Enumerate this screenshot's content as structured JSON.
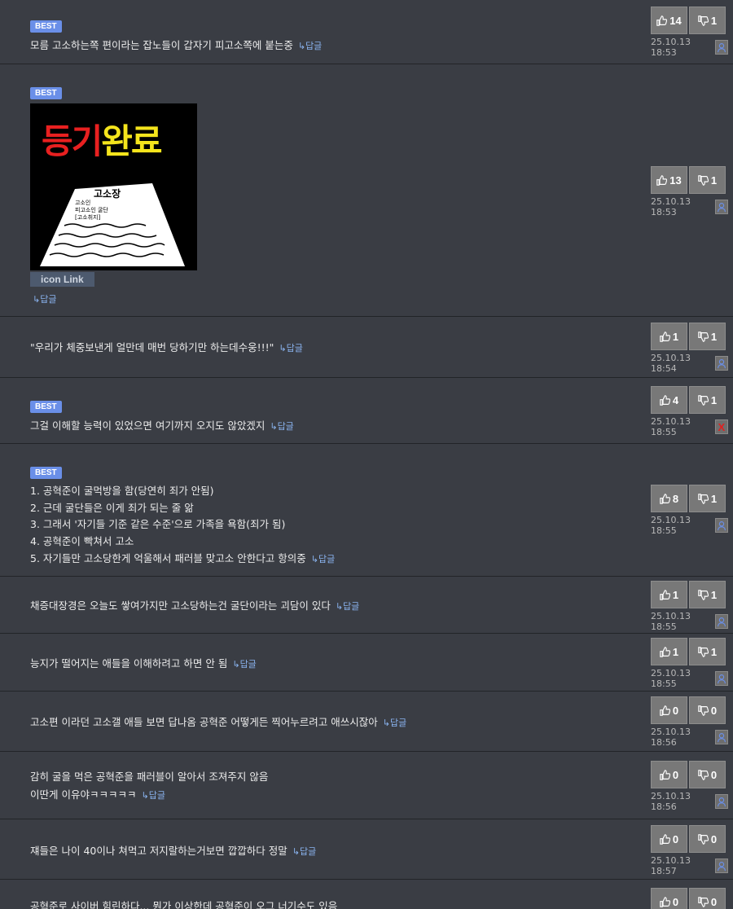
{
  "best_label": "BEST",
  "reply_label": "답글",
  "reply_arrow": "↳",
  "icon_link_label": "icon Link",
  "image": {
    "title_red1": "등",
    "title_red2": "기",
    "title_yel": "완료",
    "paper_title": "고소장",
    "paper_lines": [
      "고소인",
      "피고소인 굴단",
      "[고소취지]"
    ]
  },
  "colors": {
    "background": "#3a3d44",
    "best_badge": "#6a8fe8",
    "reply_link": "#8ab4f0",
    "vote_button": "#787878"
  },
  "comments": [
    {
      "best": true,
      "lines": [
        "모름 고소하는쪽 편이라는 잡노들이 갑자기 피고소쪽에 붙는중"
      ],
      "up": "14",
      "down": "1",
      "date": "25.10.13 18:53",
      "avatar": "user-icon"
    },
    {
      "best": true,
      "lines": [],
      "image": true,
      "up": "13",
      "down": "1",
      "date": "25.10.13 18:53",
      "avatar": "user-icon"
    },
    {
      "best": false,
      "lines": [
        "\"우리가 체중보낸게 얼만데 매번 당하기만 하는데수웅!!!\""
      ],
      "up": "1",
      "down": "1",
      "date": "25.10.13 18:54",
      "avatar": "user-icon"
    },
    {
      "best": true,
      "lines": [
        "그걸 이해할 능력이 있었으면 여기까지 오지도 않았겠지"
      ],
      "up": "4",
      "down": "1",
      "date": "25.10.13 18:55",
      "avatar": "X"
    },
    {
      "best": true,
      "lines": [
        "1. 공혁준이 굴먹방을 함(당연히 죄가 안됨)",
        "2. 근데 굴단들은 이게 죄가 되는 줄 앎",
        "3. 그래서 '자기들 기준 같은 수준'으로 가족을 욕함(죄가 됨)",
        "4. 공혁준이 빡쳐서 고소",
        "5. 자기들만 고소당한게 억울해서 패러블 맞고소 안한다고 항의중"
      ],
      "up": "8",
      "down": "1",
      "date": "25.10.13 18:55",
      "avatar": "user-icon"
    },
    {
      "best": false,
      "lines": [
        "채증대장경은 오늘도 쌓여가지만 고소당하는건 굴단이라는 괴담이 있다"
      ],
      "up": "1",
      "down": "1",
      "date": "25.10.13 18:55",
      "avatar": "user-icon"
    },
    {
      "best": false,
      "lines": [
        "능지가 떨어지는 애들을 이해하려고 하면 안 됨"
      ],
      "up": "1",
      "down": "1",
      "date": "25.10.13 18:55",
      "avatar": "user-icon"
    },
    {
      "best": false,
      "lines": [
        "고소편 이라던 고소갤 애들 보면 답나옴 공혁준 어떻게든 찍어누르려고 애쓰시잖아"
      ],
      "up": "0",
      "down": "0",
      "date": "25.10.13 18:56",
      "avatar": "user-icon"
    },
    {
      "best": false,
      "lines": [
        "감히 굴을 먹은 공혁준을 패러블이 알아서 조져주지 않음",
        "이딴게 이유야ㅋㅋㅋㅋㅋ"
      ],
      "up": "0",
      "down": "0",
      "date": "25.10.13 18:56",
      "avatar": "user-icon"
    },
    {
      "best": false,
      "lines": [
        "쟤들은 나이 40이나 쳐먹고 저지랄하는거보면 깝깝하다 정말"
      ],
      "up": "0",
      "down": "0",
      "date": "25.10.13 18:57",
      "avatar": "user-icon"
    },
    {
      "best": false,
      "lines": [
        "공혁준로 사이버 힘린하다... 뭔가 이상한데 공혁준이 오그 너기수도 있음"
      ],
      "up": "0",
      "down": "0",
      "date": "",
      "avatar": ""
    }
  ]
}
